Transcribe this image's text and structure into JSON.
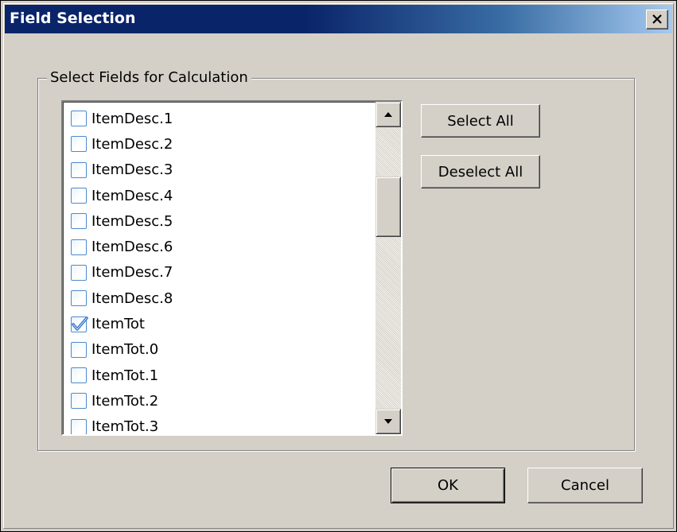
{
  "window": {
    "title": "Field Selection",
    "close_icon": "close-icon"
  },
  "group": {
    "legend": "Select Fields for Calculation"
  },
  "fields": [
    {
      "label": "ItemDesc.1",
      "checked": false
    },
    {
      "label": "ItemDesc.2",
      "checked": false
    },
    {
      "label": "ItemDesc.3",
      "checked": false
    },
    {
      "label": "ItemDesc.4",
      "checked": false
    },
    {
      "label": "ItemDesc.5",
      "checked": false
    },
    {
      "label": "ItemDesc.6",
      "checked": false
    },
    {
      "label": "ItemDesc.7",
      "checked": false
    },
    {
      "label": "ItemDesc.8",
      "checked": false
    },
    {
      "label": "ItemTot",
      "checked": true
    },
    {
      "label": "ItemTot.0",
      "checked": false
    },
    {
      "label": "ItemTot.1",
      "checked": false
    },
    {
      "label": "ItemTot.2",
      "checked": false
    },
    {
      "label": "ItemTot.3",
      "checked": false
    }
  ],
  "buttons": {
    "select_all": "Select All",
    "deselect_all": "Deselect All",
    "ok": "OK",
    "cancel": "Cancel"
  },
  "colors": {
    "title_start": "#0a246a",
    "title_end": "#a6caf0",
    "face": "#d4d0c8",
    "checkbox_border": "#4a8bd0",
    "checkmark": "#2a6fc9"
  }
}
